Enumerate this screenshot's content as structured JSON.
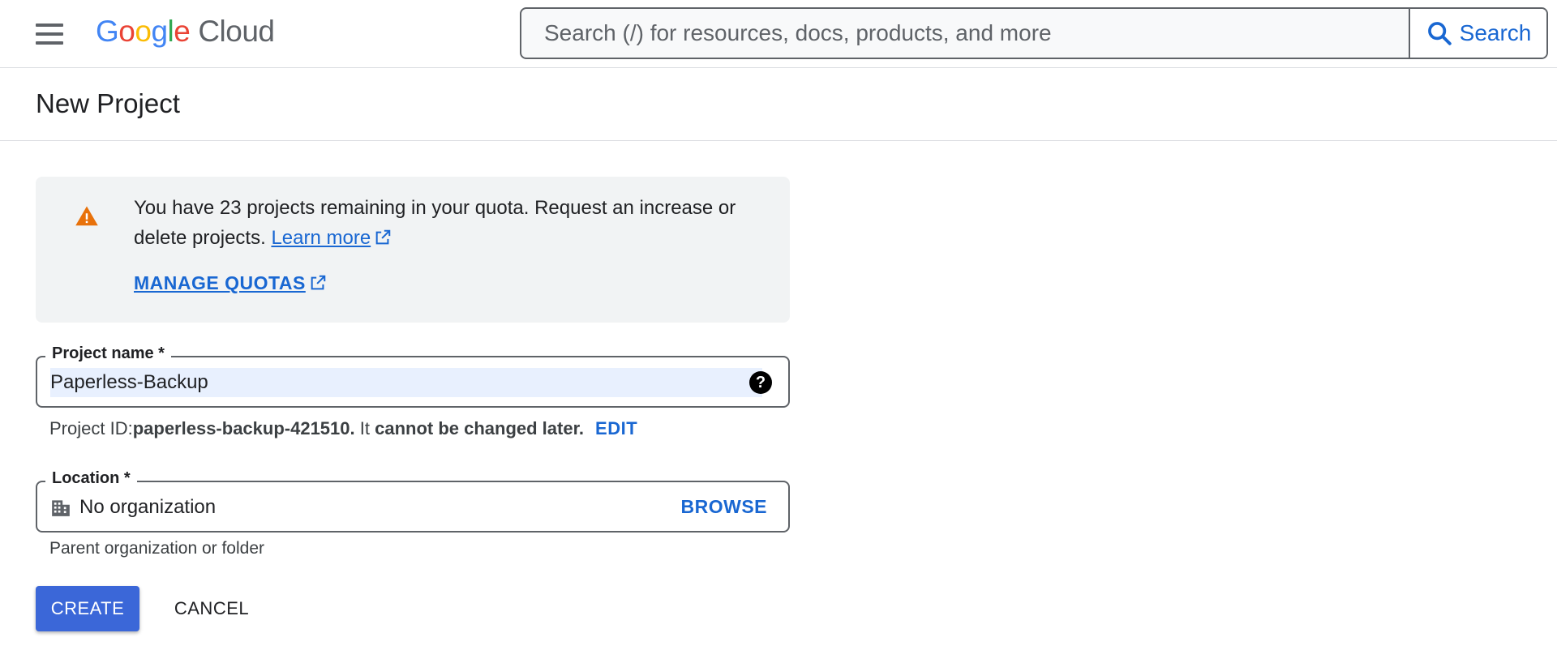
{
  "header": {
    "logo_letters": [
      {
        "char": "G",
        "color": "#4285F4"
      },
      {
        "char": "o",
        "color": "#EA4335"
      },
      {
        "char": "o",
        "color": "#FBBC05"
      },
      {
        "char": "g",
        "color": "#4285F4"
      },
      {
        "char": "l",
        "color": "#34A853"
      },
      {
        "char": "e",
        "color": "#EA4335"
      }
    ],
    "logo_g_word": "Google",
    "logo_cloud_word": "Cloud",
    "menu_icon": "hamburger-menu-icon",
    "search": {
      "placeholder": "Search (/) for resources, docs, products, and more",
      "value": "",
      "button_label": "Search",
      "button_icon": "search-icon"
    }
  },
  "page": {
    "title": "New Project"
  },
  "notice": {
    "icon": "warning-icon",
    "icon_color": "#E8710A",
    "message_line": "You have 23 projects remaining in your quota. Request an increase or delete projects.",
    "learn_more_label": "Learn more",
    "manage_quotas_label": "MANAGE QUOTAS"
  },
  "form": {
    "project_name": {
      "label": "Project name *",
      "value": "Paperless-Backup",
      "help_icon": "help-icon"
    },
    "project_id": {
      "prefix": "Project ID: ",
      "id_value": "paperless-backup-421510.",
      "suffix_plain": " It ",
      "suffix_bold": "cannot be changed later.",
      "edit_label": "EDIT"
    },
    "location": {
      "label": "Location *",
      "value": "No organization",
      "icon": "organization-icon",
      "browse_label": "BROWSE",
      "hint": "Parent organization or folder"
    }
  },
  "actions": {
    "create_label": "CREATE",
    "cancel_label": "CANCEL"
  },
  "colors": {
    "accent": "#1967D2",
    "primary_button": "#3B67D8",
    "notice_background": "#F1F3F4",
    "input_highlight": "#E8F0FE"
  }
}
